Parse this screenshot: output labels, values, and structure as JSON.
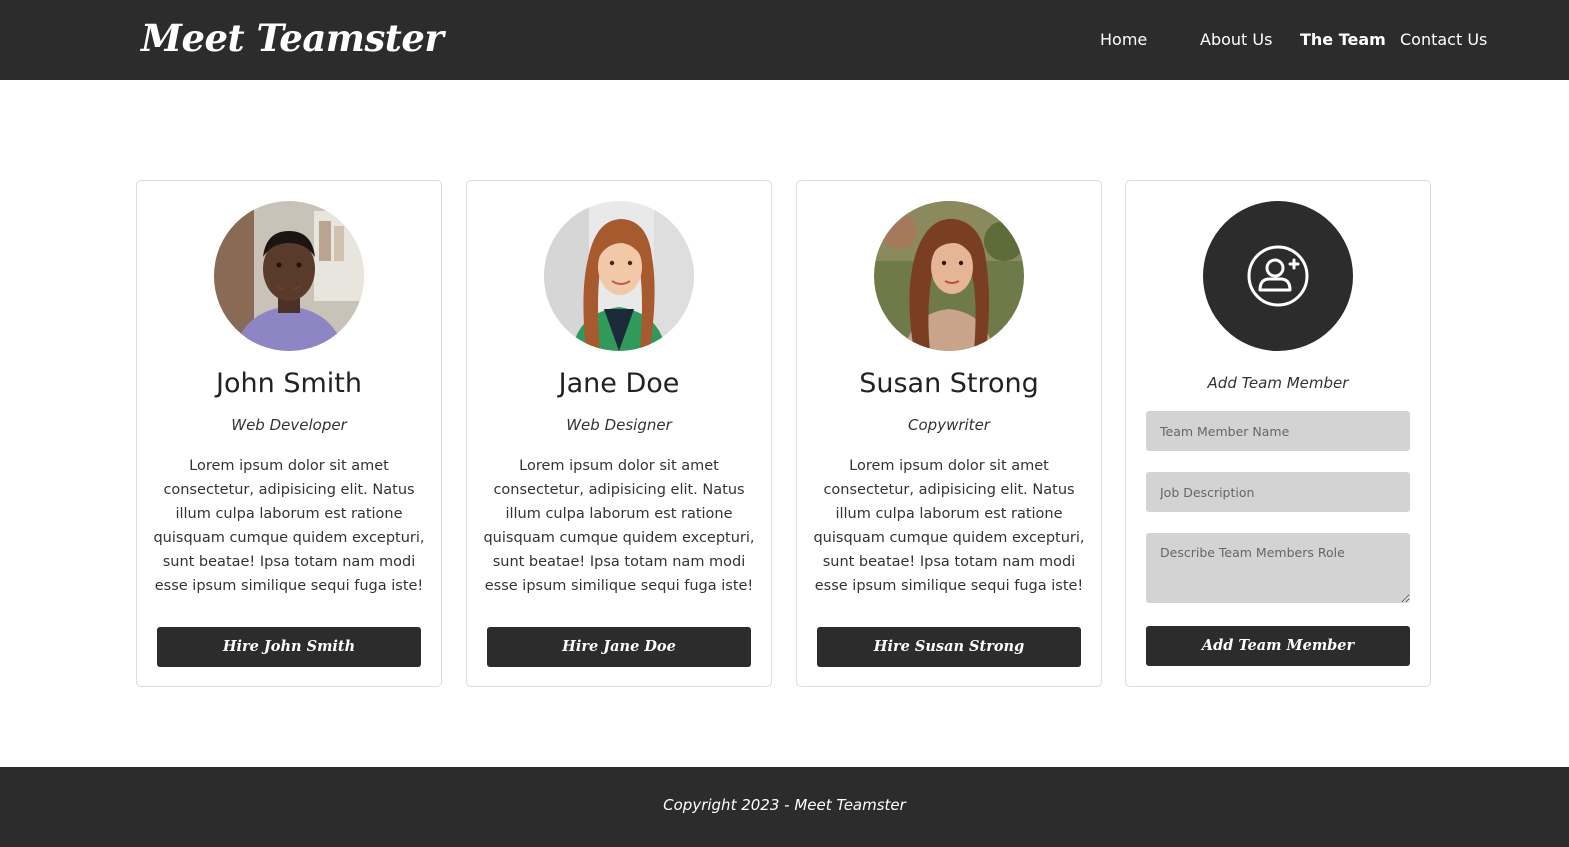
{
  "brand": "Meet Teamster",
  "nav": {
    "home": "Home",
    "about": "About Us",
    "team": "The Team",
    "contact": "Contact Us"
  },
  "members": [
    {
      "name": "John Smith",
      "role": "Web Developer",
      "description": "Lorem ipsum dolor sit amet consectetur, adipisicing elit. Natus illum culpa laborum est ratione quisquam cumque quidem excepturi, sunt beatae! Ipsa totam nam modi esse ipsum similique sequi fuga iste!",
      "button": "Hire John Smith"
    },
    {
      "name": "Jane Doe",
      "role": "Web Designer",
      "description": "Lorem ipsum dolor sit amet consectetur, adipisicing elit. Natus illum culpa laborum est ratione quisquam cumque quidem excepturi, sunt beatae! Ipsa totam nam modi esse ipsum similique sequi fuga iste!",
      "button": "Hire Jane Doe"
    },
    {
      "name": "Susan Strong",
      "role": "Copywriter",
      "description": "Lorem ipsum dolor sit amet consectetur, adipisicing elit. Natus illum culpa laborum est ratione quisquam cumque quidem excepturi, sunt beatae! Ipsa totam nam modi esse ipsum similique sequi fuga iste!",
      "button": "Hire Susan Strong"
    }
  ],
  "add_member": {
    "title": "Add Team Member",
    "name_placeholder": "Team Member Name",
    "job_placeholder": "Job Description",
    "role_placeholder": "Describe Team Members Role",
    "button": "Add Team Member",
    "icon": "user-plus-icon"
  },
  "footer": {
    "copyright": "Copyright 2023 - Meet Teamster"
  },
  "colors": {
    "dark": "#2c2c2c",
    "field": "#d3d3d3",
    "border": "#dcdcdc"
  }
}
